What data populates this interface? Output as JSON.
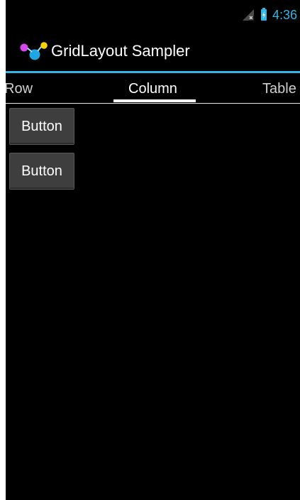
{
  "status_bar": {
    "time": "4:36",
    "icons": [
      "signal-icon",
      "battery-icon"
    ],
    "time_color": "#33b5e5"
  },
  "action_bar": {
    "title": "GridLayout Sampler",
    "icon": "app-icon"
  },
  "tabs": [
    {
      "label": "Row",
      "selected": false
    },
    {
      "label": "Column",
      "selected": true
    },
    {
      "label": "Table",
      "selected": false
    }
  ],
  "content": {
    "buttons": [
      {
        "label": "Button"
      },
      {
        "label": "Button"
      }
    ]
  },
  "colors": {
    "accent": "#33b5e5",
    "background": "#000000",
    "button_bg": "#3e3e3e"
  }
}
